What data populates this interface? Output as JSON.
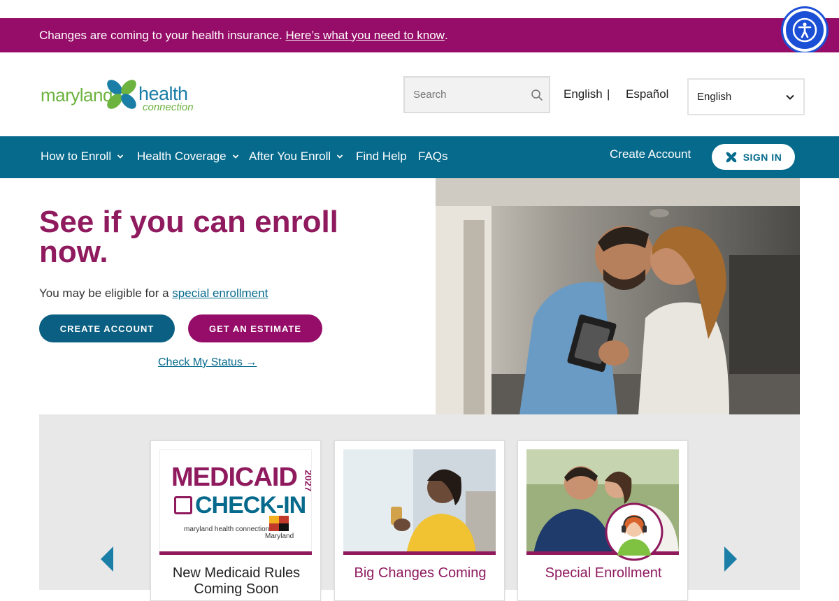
{
  "alert": {
    "text": "Changes are coming to your health insurance.",
    "link": "Here’s what you need to know",
    "trail": "."
  },
  "header": {
    "logo": {
      "word1": "maryland",
      "word2": "health",
      "word3": "connection"
    },
    "search": {
      "placeholder": "Search"
    },
    "lang_links": {
      "english": "English",
      "sep": "|",
      "espanol": "Español"
    },
    "lang_select": {
      "value": "English"
    }
  },
  "nav": {
    "items": [
      {
        "label": "How to Enroll"
      },
      {
        "label": "Health Coverage"
      },
      {
        "label": "After You Enroll"
      },
      {
        "label": "Find Help"
      },
      {
        "label": "FAQs"
      }
    ],
    "create_account": "Create Account",
    "sign_in": "SIGN IN"
  },
  "hero": {
    "title": "See if you can enroll now.",
    "sub_text": "You may be eligible for a",
    "sub_link": "special enrollment",
    "btn_create": "CREATE ACCOUNT",
    "btn_estimate": "GET AN ESTIMATE",
    "check_status": "Check My Status →"
  },
  "cards": [
    {
      "title": "New Medicaid Rules Coming Soon",
      "thumb_line1": "MEDICAID",
      "thumb_line2": "CHECK-IN",
      "thumb_year": "2027",
      "thumb_brand": "maryland health connection",
      "thumb_state": "Maryland"
    },
    {
      "title": "Big Changes Coming"
    },
    {
      "title": "Special Enrollment"
    }
  ],
  "colors": {
    "magenta": "#950d68",
    "teal": "#066a8c",
    "green": "#6cb33f",
    "a11y_blue": "#1a4fd6"
  }
}
